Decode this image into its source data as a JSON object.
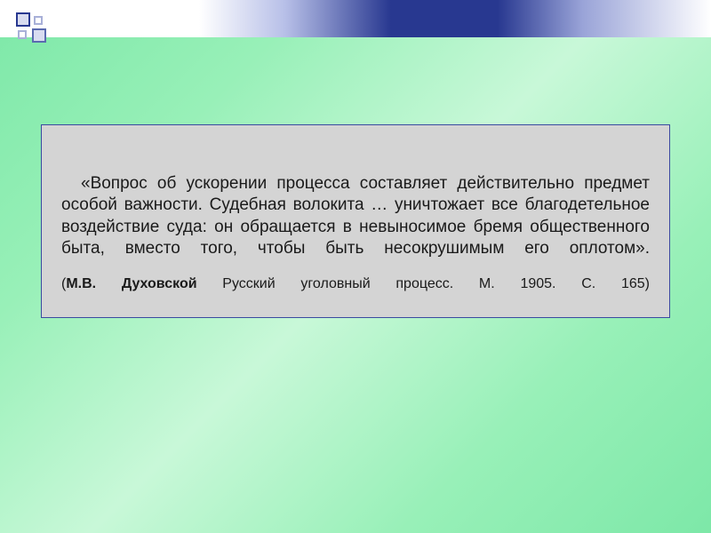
{
  "quote": {
    "text": "«Вопрос об ускорении процесса составляет действительно предмет особой важности. Судебная волокита … уничтожает все благодетельное воздействие суда: он обращается в невыносимое бремя общественного быта, вместо того, чтобы быть несокрушимым его оплотом».",
    "citation_open": "(",
    "author": "М.В. Духовской",
    "rest": " Русский уголовный процесс. М. 1905. С. 165)"
  }
}
